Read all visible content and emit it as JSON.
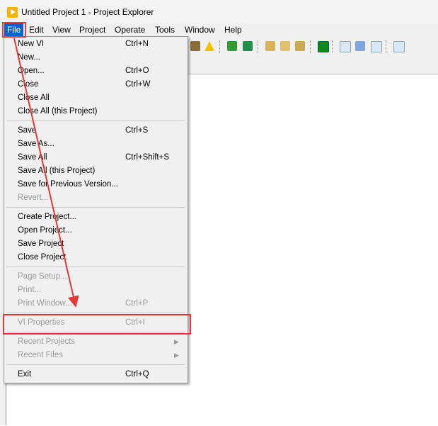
{
  "window": {
    "title": "Untitled Project 1 - Project Explorer"
  },
  "menubar": {
    "items": [
      {
        "label": "File"
      },
      {
        "label": "Edit"
      },
      {
        "label": "View"
      },
      {
        "label": "Project"
      },
      {
        "label": "Operate"
      },
      {
        "label": "Tools"
      },
      {
        "label": "Window"
      },
      {
        "label": "Help"
      }
    ]
  },
  "file_menu": {
    "groups": [
      [
        {
          "label": "New VI",
          "shortcut": "Ctrl+N",
          "enabled": true
        },
        {
          "label": "New...",
          "shortcut": "",
          "enabled": true
        },
        {
          "label": "Open...",
          "shortcut": "Ctrl+O",
          "enabled": true
        },
        {
          "label": "Close",
          "shortcut": "Ctrl+W",
          "enabled": true
        },
        {
          "label": "Close All",
          "shortcut": "",
          "enabled": true
        },
        {
          "label": "Close All (this Project)",
          "shortcut": "",
          "enabled": true
        }
      ],
      [
        {
          "label": "Save",
          "shortcut": "Ctrl+S",
          "enabled": true
        },
        {
          "label": "Save As...",
          "shortcut": "",
          "enabled": true
        },
        {
          "label": "Save All",
          "shortcut": "Ctrl+Shift+S",
          "enabled": true
        },
        {
          "label": "Save All (this Project)",
          "shortcut": "",
          "enabled": true
        },
        {
          "label": "Save for Previous Version...",
          "shortcut": "",
          "enabled": true
        },
        {
          "label": "Revert...",
          "shortcut": "",
          "enabled": false
        }
      ],
      [
        {
          "label": "Create Project...",
          "shortcut": "",
          "enabled": true
        },
        {
          "label": "Open Project...",
          "shortcut": "",
          "enabled": true
        },
        {
          "label": "Save Project",
          "shortcut": "",
          "enabled": true
        },
        {
          "label": "Close Project",
          "shortcut": "",
          "enabled": true
        }
      ],
      [
        {
          "label": "Page Setup...",
          "shortcut": "",
          "enabled": false
        },
        {
          "label": "Print...",
          "shortcut": "",
          "enabled": false
        },
        {
          "label": "Print Window...",
          "shortcut": "Ctrl+P",
          "enabled": false
        }
      ],
      [
        {
          "label": "VI Properties",
          "shortcut": "Ctrl+I",
          "enabled": false
        }
      ],
      [
        {
          "label": "Recent Projects",
          "shortcut": "",
          "enabled": false,
          "submenu": true
        },
        {
          "label": "Recent Files",
          "shortcut": "",
          "enabled": false,
          "submenu": true
        }
      ],
      [
        {
          "label": "Exit",
          "shortcut": "Ctrl+Q",
          "enabled": true
        }
      ]
    ]
  },
  "toolbar": {
    "icons": [
      "explore-icon",
      "warning-icon",
      "add-file-icon",
      "add-folder-icon",
      "build-icon",
      "settings-icon",
      "deploy-icon",
      "project-icon",
      "page-icon",
      "undo-icon",
      "zoom-icon",
      "find-icon"
    ]
  },
  "annotation_colors": {
    "highlight": "#e53935"
  }
}
